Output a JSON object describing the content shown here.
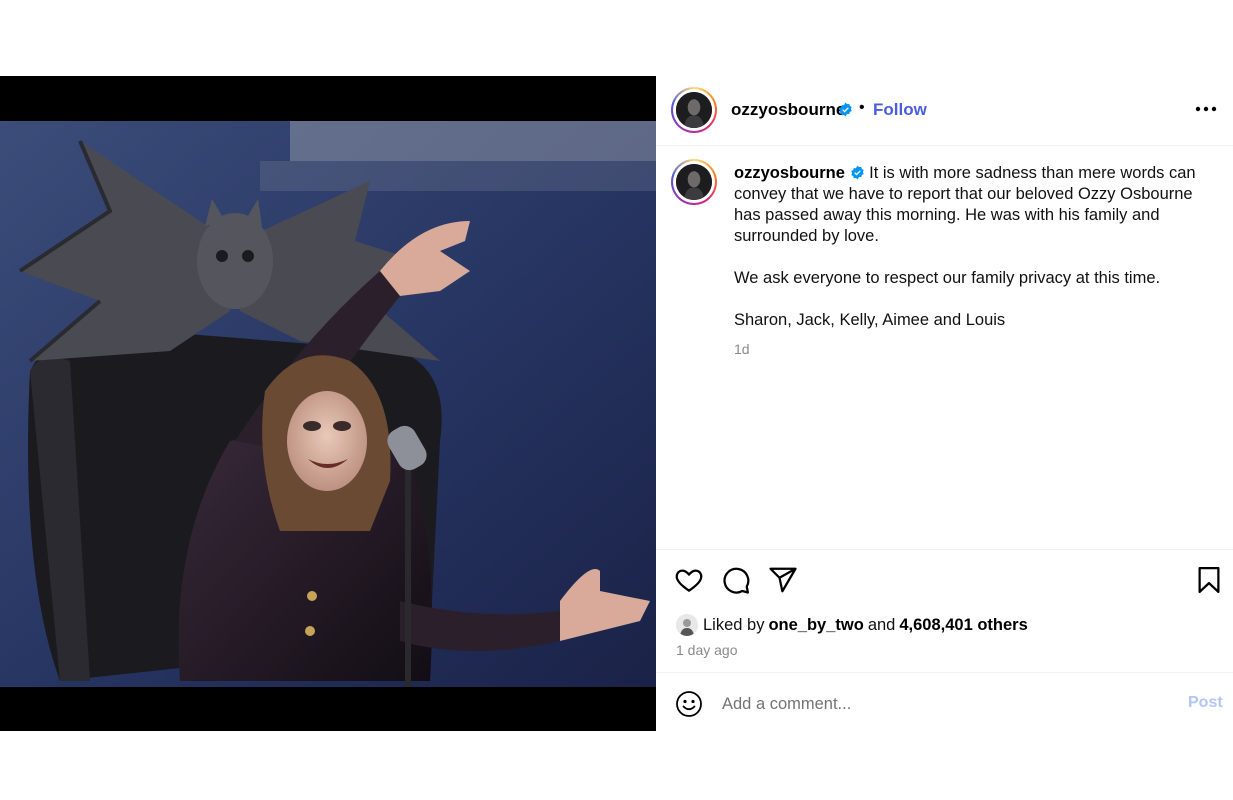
{
  "post": {
    "username": "ozzyosbourne",
    "follow_label": "Follow",
    "separator": "•",
    "caption_paragraphs": [
      "It is with more sadness than mere words can convey that we have to report that our beloved Ozzy Osbourne has passed away this morning. He was with his family and surrounded by love.",
      "We ask everyone to respect our family privacy at this time.",
      "Sharon, Jack, Kelly, Aimee and Louis"
    ],
    "caption_time": "1d",
    "liked_prefix": "Liked by",
    "liked_user": "one_by_two",
    "liked_and": "and",
    "liked_others": "4,608,401 others",
    "time_ago": "1 day ago"
  },
  "comment": {
    "placeholder": "Add a comment...",
    "post_label": "Post"
  },
  "icons": {
    "verified": "verified-badge-icon",
    "more": "more-options-icon",
    "like": "heart-icon",
    "comment": "comment-bubble-icon",
    "share": "paper-plane-icon",
    "save": "bookmark-icon",
    "emoji": "emoji-smiley-icon"
  },
  "colors": {
    "follow": "#4a5de0",
    "verified": "#0095f6",
    "post_disabled": "#b2c6f5",
    "muted": "#8a8a8a"
  }
}
